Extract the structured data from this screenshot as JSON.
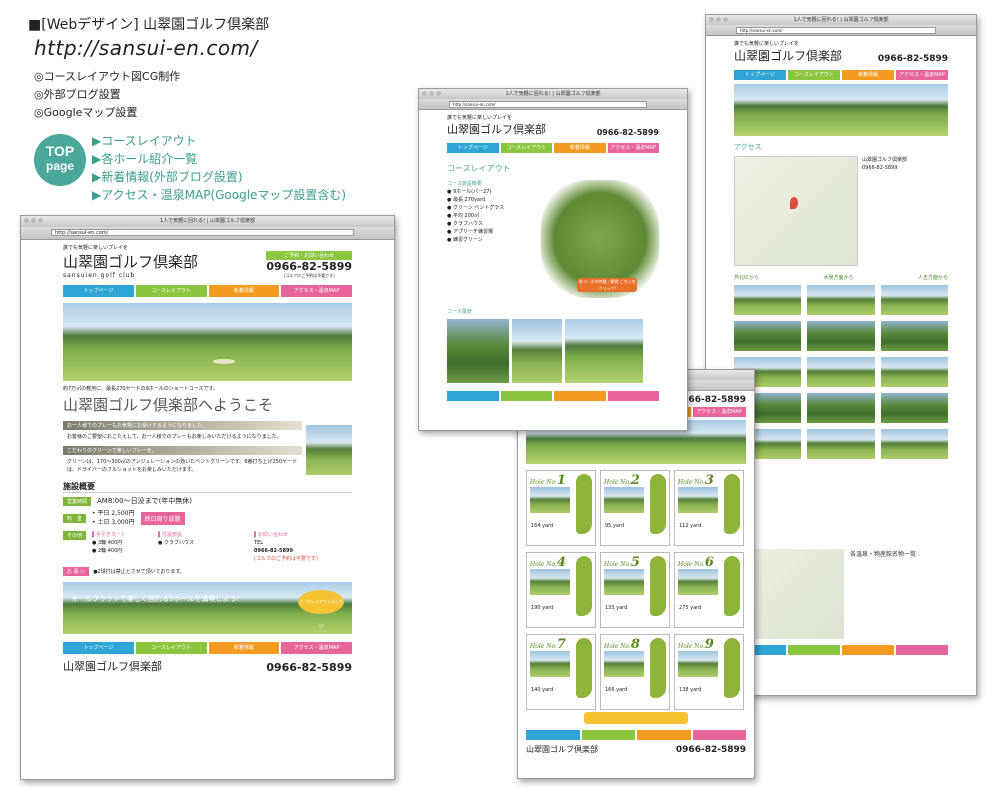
{
  "header": {
    "title": "■[Webデザイン] 山翠園ゴルフ倶楽部",
    "url": "http://sansui-en.com/",
    "features": [
      "◎コースレイアウト図CG制作",
      "◎外部ブログ設置",
      "◎Googleマップ設置"
    ]
  },
  "top_badge": {
    "line1": "TOP",
    "line2": "page"
  },
  "top_list": [
    "▶コースレイアウト",
    "▶各ホール紹介一覧",
    "▶新着情報(外部ブログ設置)",
    "▶アクセス・温泉MAP(Googleマップ設置含む)"
  ],
  "browser": {
    "title": "1人で気軽に回れる! | 山翠園ゴルフ倶楽部",
    "address": "http://sansui-en.com/"
  },
  "site": {
    "tagline": "誰でも気軽に楽しいプレイを",
    "logo": "山翠園ゴルフ倶楽部",
    "logo_en": "sansuien golf club",
    "tel_label": "ご予約・お問い合わせ",
    "tel": "0966-82-5899",
    "tel_note": "(ゴルフのご予約は不要です)",
    "nav": [
      "トップページ",
      "コースレイアウト",
      "新着情報",
      "アクセス・温泉MAP"
    ]
  },
  "main": {
    "intro": "約7万㎡の敷地に、最長270ヤードの9ホールのショートコースです。",
    "welcome": "山翠園ゴルフ倶楽部へようこそ",
    "point1_bar": "お一人様でのプレーもお気軽にお受けするようになりました。",
    "point1_text": "お客様のご要望におこたえして、お一人様でのプレーもお楽しみいただけるようになりました。",
    "point2_bar": "こだわりのグリーンで楽しいプレーを。",
    "point2_text": "グリーンは、170〜300㎡のアンジュレーションの効いたベントグリーンです。6番打ち上げ250ヤードは、ドライバーのフルショットをお楽しみいただけます。",
    "facility_title": "施設概要",
    "hours_label": "営業時間",
    "hours": "AM8:00〜日没まで(年中無休)",
    "fee_label": "料　金",
    "fee_weekday": "• 平日 2,500円",
    "fee_weekend": "• 土日 3,000円",
    "fee_badge": "終日周り放題",
    "other_label": "その他",
    "cart_title": "▌手引きカート",
    "cart1": "● 3輪 400円",
    "cart2": "● 2輪 400円",
    "attached_title": "▌付設施設",
    "attached1": "● クラブハウス",
    "contact_title": "▌お問い合わせ",
    "contact_tel": "TEL",
    "contact_num": "0966-82-5899",
    "contact_note": "(ゴルフのご予約は不要です)",
    "request_label": "お 願 い",
    "request_text": "●2球打は禁止とさせて頂いております。",
    "banner_text": "オールフラットで楽しく回れる9ホールを満喫しよう!",
    "banner_btn": "コースレイアウトはこちら!"
  },
  "course_page": {
    "heading": "コースレイアウト",
    "data_title": "コース施設概要",
    "items": [
      "● 9ホール(パー27)",
      "● 最長 270yard",
      "● グリーン ベントグラス",
      "● 平均 200㎡",
      "● クラブハウス",
      "● アプリーチ練習場",
      "● 練習グリーン"
    ],
    "cta": "各コースの特徴・解説 こちらをクリック!",
    "scenery": "コース風景"
  },
  "holes": [
    {
      "no": "1",
      "yard": "164 yard"
    },
    {
      "no": "2",
      "yard": "95 yard"
    },
    {
      "no": "3",
      "yard": "112 yard"
    },
    {
      "no": "4",
      "yard": "190 yard"
    },
    {
      "no": "5",
      "yard": "133 yard"
    },
    {
      "no": "6",
      "yard": "275 yard"
    },
    {
      "no": "7",
      "yard": "140 yard"
    },
    {
      "no": "8",
      "yard": "166 yard"
    },
    {
      "no": "9",
      "yard": "138 yard"
    }
  ],
  "access_page": {
    "heading": "アクセス",
    "club": "山翠園ゴルフ倶楽部",
    "route_a": "芦北ICから",
    "route_b": "水俣方面から",
    "route_c": "人吉方面から",
    "onsen_title": "各温泉・物産館名物一覧"
  },
  "colors": {
    "teal": "#4aa79a",
    "nav_blue": "#2ea5d4",
    "nav_green": "#8cc63f",
    "nav_orange": "#f39b1f",
    "nav_pink": "#e8659b"
  }
}
